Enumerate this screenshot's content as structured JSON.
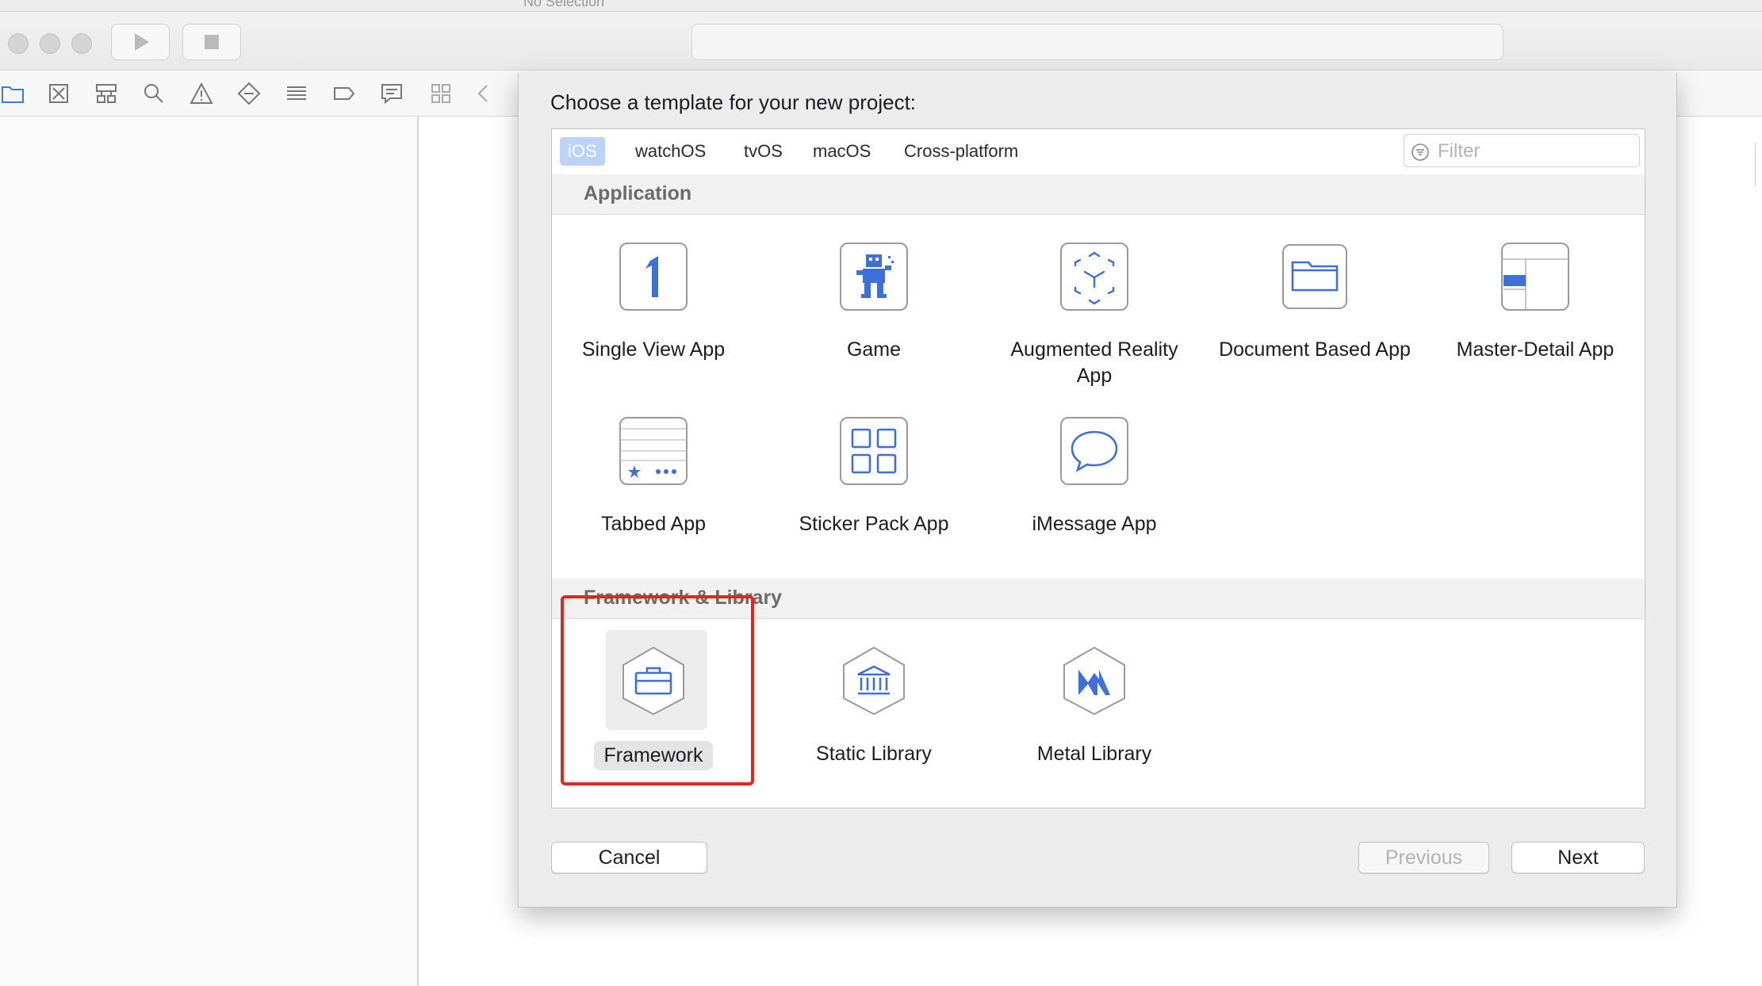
{
  "window": {
    "navigator_status": "No Selection"
  },
  "sheet": {
    "title": "Choose a template for your new project:",
    "platform_tabs": [
      {
        "label": "iOS",
        "active": true
      },
      {
        "label": "watchOS",
        "active": false
      },
      {
        "label": "tvOS",
        "active": false
      },
      {
        "label": "macOS",
        "active": false
      },
      {
        "label": "Cross-platform",
        "active": false
      }
    ],
    "filter": {
      "placeholder": "Filter",
      "value": ""
    },
    "sections": [
      {
        "title": "Application",
        "templates": [
          {
            "label": "Single View App",
            "icon": "single-view-app-icon"
          },
          {
            "label": "Game",
            "icon": "game-icon"
          },
          {
            "label": "Augmented Reality App",
            "icon": "augmented-reality-icon"
          },
          {
            "label": "Document Based App",
            "icon": "document-folder-icon"
          },
          {
            "label": "Master-Detail App",
            "icon": "master-detail-icon"
          },
          {
            "label": "Tabbed App",
            "icon": "tabbed-app-icon"
          },
          {
            "label": "Sticker Pack App",
            "icon": "sticker-pack-icon"
          },
          {
            "label": "iMessage App",
            "icon": "imessage-icon"
          }
        ]
      },
      {
        "title": "Framework & Library",
        "templates": [
          {
            "label": "Framework",
            "icon": "framework-toolbox-icon",
            "selected": true
          },
          {
            "label": "Static Library",
            "icon": "static-library-icon"
          },
          {
            "label": "Metal Library",
            "icon": "metal-library-icon"
          }
        ]
      }
    ],
    "buttons": {
      "cancel": "Cancel",
      "previous": "Previous",
      "next": "Next"
    },
    "colors": {
      "accent": "#3f6fd8",
      "tab_active": "#bcd3f7",
      "highlight_box": "#e0261f"
    }
  }
}
